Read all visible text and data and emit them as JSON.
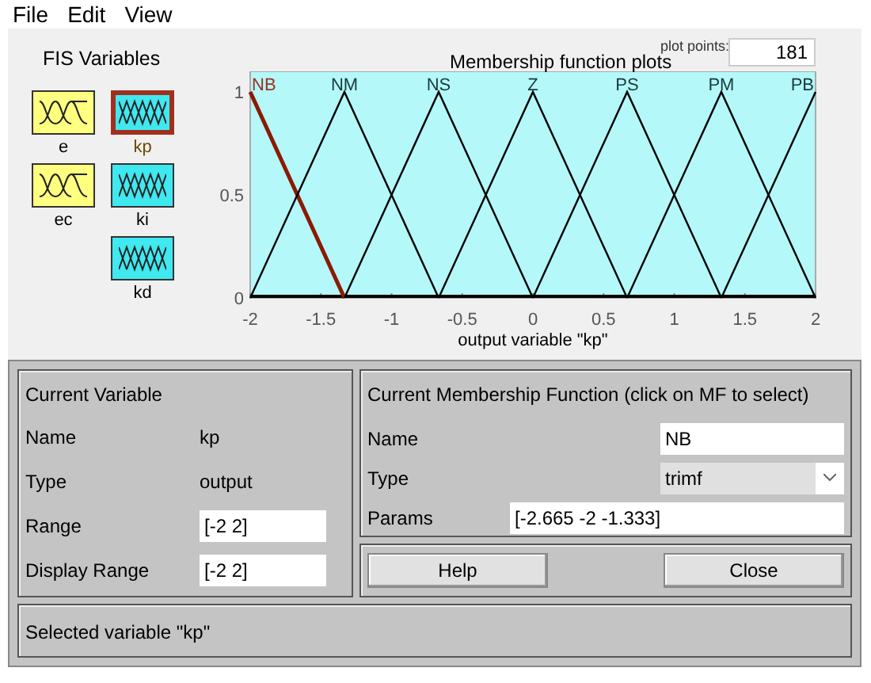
{
  "menu": [
    "File",
    "Edit",
    "View"
  ],
  "fis_variables": {
    "title": "FIS Variables",
    "items": [
      {
        "name": "e",
        "kind": "input",
        "selected": false
      },
      {
        "name": "kp",
        "kind": "output",
        "selected": true
      },
      {
        "name": "ec",
        "kind": "input",
        "selected": false
      },
      {
        "name": "ki",
        "kind": "output",
        "selected": false
      },
      {
        "name": "kd",
        "kind": "output",
        "selected": false
      }
    ]
  },
  "plot": {
    "plot_points_label": "plot points:",
    "plot_points": "181",
    "chart_data": {
      "type": "line",
      "title": "Membership function plots",
      "xlabel": "output variable \"kp\"",
      "x": [
        -2,
        -1.333,
        -0.667,
        0,
        0.667,
        1.333,
        2
      ],
      "xlim": [
        -2,
        2
      ],
      "ylim": [
        0,
        1.1
      ],
      "xticks": [
        -2,
        -1.5,
        -1,
        -0.5,
        0,
        0.5,
        1,
        1.5,
        2
      ],
      "yticks": [
        0,
        0.5,
        1
      ],
      "series": [
        {
          "name": "NB",
          "color": "#8b1a00",
          "values": [
            1,
            0,
            null,
            null,
            null,
            null,
            null
          ]
        },
        {
          "name": "NM",
          "color": "#000000",
          "values": [
            0,
            1,
            0,
            null,
            null,
            null,
            null
          ]
        },
        {
          "name": "NS",
          "color": "#000000",
          "values": [
            null,
            0,
            1,
            0,
            null,
            null,
            null
          ]
        },
        {
          "name": "Z",
          "color": "#000000",
          "values": [
            null,
            null,
            0,
            1,
            0,
            null,
            null
          ]
        },
        {
          "name": "PS",
          "color": "#000000",
          "values": [
            null,
            null,
            null,
            0,
            1,
            0,
            null
          ]
        },
        {
          "name": "PM",
          "color": "#000000",
          "values": [
            null,
            null,
            null,
            null,
            0,
            1,
            0
          ]
        },
        {
          "name": "PB",
          "color": "#000000",
          "values": [
            null,
            null,
            null,
            null,
            null,
            0,
            1
          ]
        }
      ]
    },
    "mf_states": [
      {
        "selected": true
      },
      {
        "selected": false
      },
      {
        "selected": false
      },
      {
        "selected": false
      },
      {
        "selected": false
      },
      {
        "selected": false
      },
      {
        "selected": false
      }
    ]
  },
  "current_variable": {
    "title": "Current Variable",
    "rows": [
      {
        "label": "Name",
        "kind": "text",
        "value": "kp"
      },
      {
        "label": "Type",
        "kind": "text",
        "value": "output"
      },
      {
        "label": "Range",
        "kind": "field",
        "value": "[-2 2]"
      },
      {
        "label": "Display Range",
        "kind": "field",
        "value": "[-2 2]"
      }
    ]
  },
  "current_mf": {
    "title": "Current Membership Function (click on MF to select)",
    "rows": [
      {
        "label": "Name",
        "kind": "field",
        "value": "NB"
      },
      {
        "label": "Type",
        "kind": "dropdown",
        "value": "trimf"
      },
      {
        "label": "Params",
        "kind": "wide-field",
        "value": "[-2.665 -2 -1.333]"
      }
    ]
  },
  "buttons": [
    "Help",
    "Close"
  ],
  "status": "Selected variable \"kp\""
}
